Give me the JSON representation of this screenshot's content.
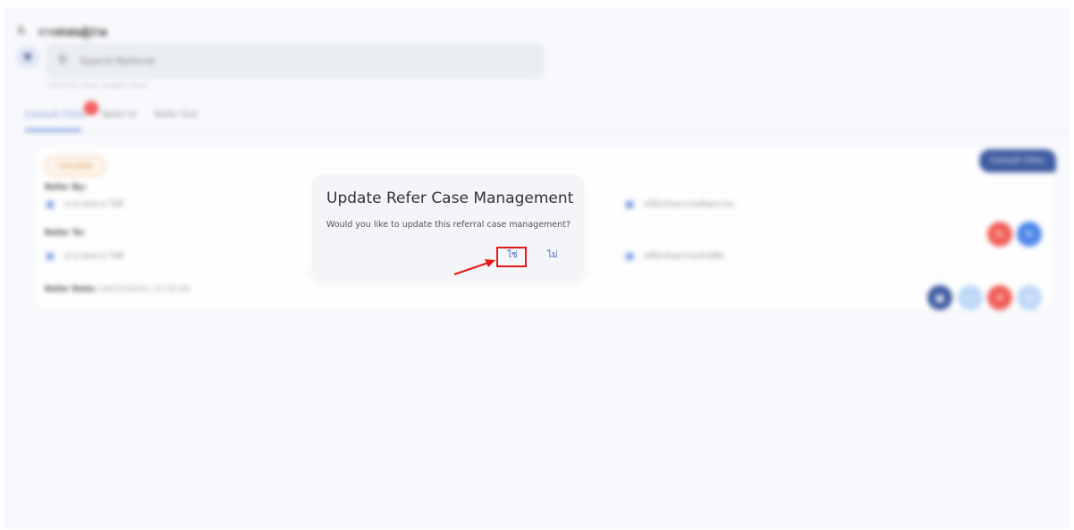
{
  "header": {
    "title": "การส่งต่อผู้ป่วย",
    "icon": "wheelchair-icon"
  },
  "filter": {
    "icon": "filter-icon"
  },
  "search": {
    "placeholder": "Search Referral",
    "hint": "Search by name, hospital name"
  },
  "tabs": [
    {
      "label": "Consult Clinic",
      "badge": "1",
      "active": true
    },
    {
      "label": "Refer In"
    },
    {
      "label": "Refer Out"
    }
  ],
  "card": {
    "tag": "Consult Clinic",
    "status": "consulted",
    "refer_by_label": "Refer By:",
    "refer_by_value": "นาย สมชาย ใจดี",
    "refer_by_hospital": "คลินิกกันตกรรมทันตกรรม",
    "refer_to_label": "Refer To:",
    "refer_to_value": "นาย สมชาย ใจดี",
    "refer_to_hospital": "คลินิกกันตกรรมรักษ์ฟัน",
    "refer_date_label": "Refer Date:",
    "refer_date_value": "24/12/2024 | 11:52:29"
  },
  "dialog": {
    "title": "Update Refer Case Management",
    "message": "Would you like to update this referral case management?",
    "yes_label": "ใช่",
    "no_label": "ไม่"
  },
  "colors": {
    "accent": "#2f4f9b",
    "danger": "#f04040",
    "primary": "#3f7ee8",
    "highlight": "#e41a1a"
  }
}
